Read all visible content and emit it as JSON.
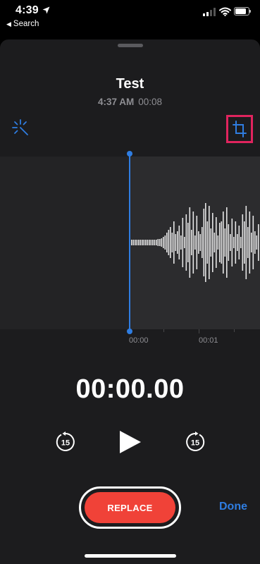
{
  "status_bar": {
    "time": "4:39",
    "back_label": "Search",
    "battery_level": 0.82
  },
  "recording": {
    "title": "Test",
    "date": "4:37 AM",
    "duration": "00:08"
  },
  "timeline": {
    "labels": [
      "00:00",
      "00:01"
    ]
  },
  "player": {
    "elapsed": "00:00.00",
    "skip_back_label": "15",
    "skip_forward_label": "15"
  },
  "actions": {
    "replace_label": "REPLACE",
    "done_label": "Done"
  },
  "colors": {
    "accent": "#2f7de1",
    "record": "#f04238",
    "highlight": "#e0245e"
  },
  "icons": {
    "enhance": "magic-wand-sparkle-icon",
    "trim": "crop-icon",
    "location": "location-arrow-icon"
  }
}
